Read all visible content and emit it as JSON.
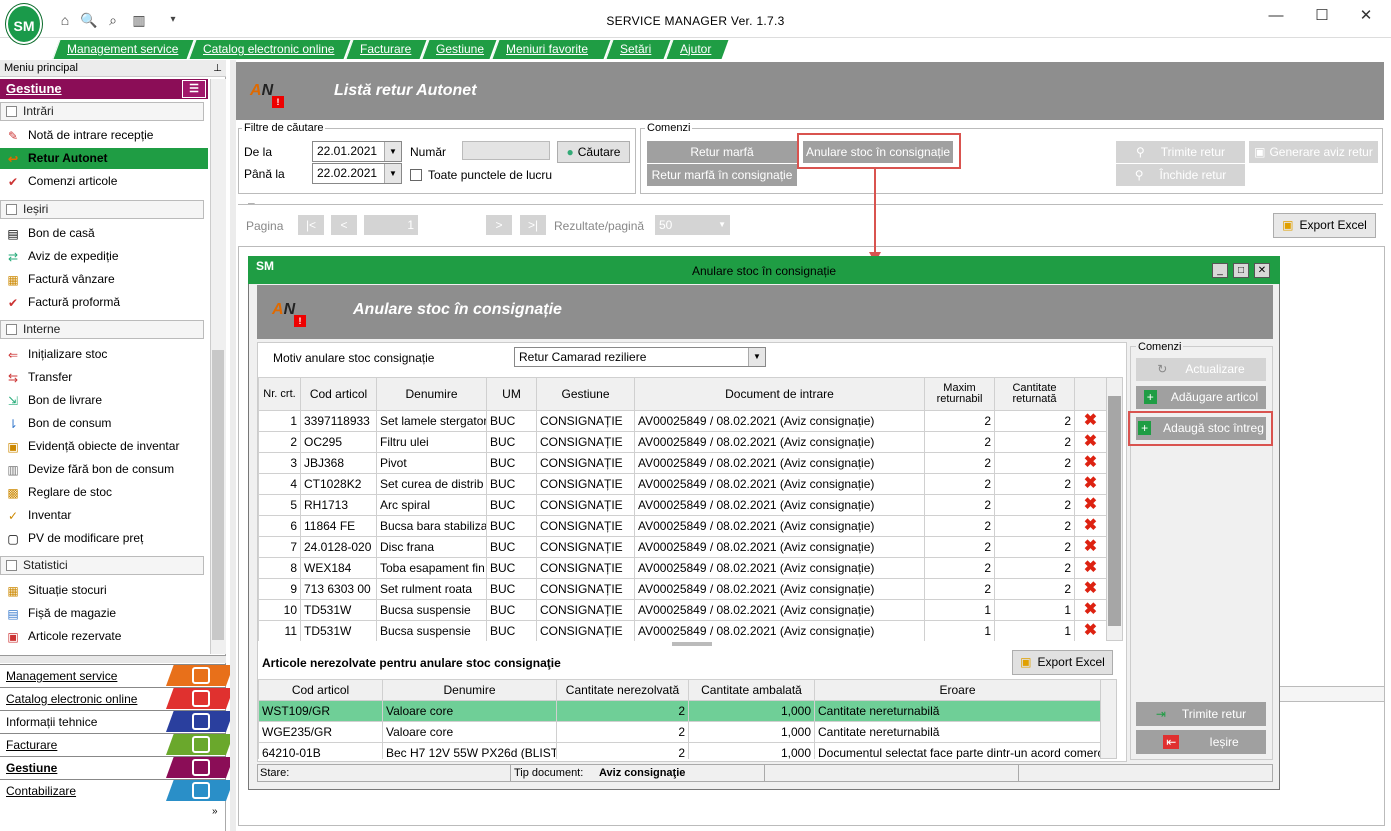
{
  "window": {
    "title": "SERVICE MANAGER Ver. 1.7.3",
    "logo_text": "SM"
  },
  "menubar": [
    "Management service",
    "Catalog electronic online",
    "Facturare",
    "Gestiune",
    "Meniuri favorite",
    "Setări",
    "Ajutor"
  ],
  "sidebar": {
    "header": "Meniu principal",
    "section_title": "Gestiune",
    "groups": [
      {
        "label": "Intrări",
        "items": [
          "Notă de intrare recepție",
          "Retur Autonet",
          "Comenzi articole"
        ]
      },
      {
        "label": "Ieșiri",
        "items": [
          "Bon de casă",
          "Aviz de expediție",
          "Factură vânzare",
          "Factură proformă"
        ]
      },
      {
        "label": "Interne",
        "items": [
          "Inițializare stoc",
          "Transfer",
          "Bon de livrare",
          "Bon de consum",
          "Evidență obiecte de inventar",
          "Devize fără bon de consum",
          "Reglare de stoc",
          "Inventar",
          "PV de modificare preț"
        ]
      },
      {
        "label": "Statistici",
        "items": [
          "Situație stocuri",
          "Fișă de magazie",
          "Articole rezervate"
        ]
      }
    ],
    "active_item": "Retur Autonet",
    "modules": [
      "Management service",
      "Catalog electronic online",
      "Informații tehnice",
      "Facturare",
      "Gestiune",
      "Contabilizare"
    ],
    "module_colors": [
      "#e8701a",
      "#e0312f",
      "#2a3f9e",
      "#6aa82c",
      "#8b0d57",
      "#2a8fc8"
    ]
  },
  "main": {
    "title": "Listă retur Autonet",
    "filters": {
      "group_label": "Filtre de căutare",
      "from_label": "De la",
      "from_value": "22.01.2021",
      "to_label": "Până la",
      "to_value": "22.02.2021",
      "number_label": "Număr",
      "number_value": "",
      "all_points_label": "Toate punctele de lucru",
      "search_button": "Căutare"
    },
    "commands": {
      "group_label": "Comenzi",
      "retur_marfa": "Retur marfă",
      "anulare_stoc": "Anulare stoc în consignație",
      "retur_marfa_consignatie": "Retur marfă în consignație",
      "trimite_retur": "Trimite retur",
      "inchide_retur": "Închide retur",
      "generare_aviz": "Generare aviz retur"
    },
    "pager": {
      "page_label": "Pagina",
      "page_value": "1",
      "first": "|<",
      "prev": "<",
      "next": ">",
      "last": ">|",
      "results_label": "Rezultate/pagină",
      "results_value": "50"
    },
    "export_button": "Export Excel"
  },
  "modal": {
    "window_title": "Anulare stoc în consignație",
    "header": "Anulare stoc în consignație",
    "motiv_label": "Motiv anulare stoc consignație",
    "motiv_value": "Retur Camarad reziliere",
    "columns": [
      "Nr. crt.",
      "Cod articol",
      "Denumire",
      "UM",
      "Gestiune",
      "Document de intrare",
      "Maxim returnabil",
      "Cantitate returnată"
    ],
    "rows": [
      {
        "nr": "1",
        "cod": "3397118933",
        "den": "Set lamele stergator",
        "um": "BUC",
        "gest": "CONSIGNAȚIE",
        "doc": "AV00025849 / 08.02.2021 (Aviz consignație)",
        "max": "2",
        "cant": "2"
      },
      {
        "nr": "2",
        "cod": "OC295",
        "den": "Filtru ulei",
        "um": "BUC",
        "gest": "CONSIGNAȚIE",
        "doc": "AV00025849 / 08.02.2021 (Aviz consignație)",
        "max": "2",
        "cant": "2"
      },
      {
        "nr": "3",
        "cod": "JBJ368",
        "den": "Pivot",
        "um": "BUC",
        "gest": "CONSIGNAȚIE",
        "doc": "AV00025849 / 08.02.2021 (Aviz consignație)",
        "max": "2",
        "cant": "2"
      },
      {
        "nr": "4",
        "cod": "CT1028K2",
        "den": "Set curea de distrib",
        "um": "BUC",
        "gest": "CONSIGNAȚIE",
        "doc": "AV00025849 / 08.02.2021 (Aviz consignație)",
        "max": "2",
        "cant": "2"
      },
      {
        "nr": "5",
        "cod": "RH1713",
        "den": "Arc spiral",
        "um": "BUC",
        "gest": "CONSIGNAȚIE",
        "doc": "AV00025849 / 08.02.2021 (Aviz consignație)",
        "max": "2",
        "cant": "2"
      },
      {
        "nr": "6",
        "cod": "11864 FE",
        "den": "Bucsa bara stabiliza",
        "um": "BUC",
        "gest": "CONSIGNAȚIE",
        "doc": "AV00025849 / 08.02.2021 (Aviz consignație)",
        "max": "2",
        "cant": "2"
      },
      {
        "nr": "7",
        "cod": "24.0128-020",
        "den": "Disc frana",
        "um": "BUC",
        "gest": "CONSIGNAȚIE",
        "doc": "AV00025849 / 08.02.2021 (Aviz consignație)",
        "max": "2",
        "cant": "2"
      },
      {
        "nr": "8",
        "cod": "WEX184",
        "den": "Toba esapament fin",
        "um": "BUC",
        "gest": "CONSIGNAȚIE",
        "doc": "AV00025849 / 08.02.2021 (Aviz consignație)",
        "max": "2",
        "cant": "2"
      },
      {
        "nr": "9",
        "cod": "713 6303 00",
        "den": "Set rulment roata",
        "um": "BUC",
        "gest": "CONSIGNAȚIE",
        "doc": "AV00025849 / 08.02.2021 (Aviz consignație)",
        "max": "2",
        "cant": "2"
      },
      {
        "nr": "10",
        "cod": "TD531W",
        "den": "Bucsa suspensie",
        "um": "BUC",
        "gest": "CONSIGNAȚIE",
        "doc": "AV00025849 / 08.02.2021 (Aviz consignație)",
        "max": "1",
        "cant": "1"
      },
      {
        "nr": "11",
        "cod": "TD531W",
        "den": "Bucsa suspensie",
        "um": "BUC",
        "gest": "CONSIGNAȚIE",
        "doc": "AV00025849 / 08.02.2021 (Aviz consignație)",
        "max": "1",
        "cant": "1"
      }
    ],
    "unresolved_title": "Articole nerezolvate pentru anulare stoc consignaţie",
    "export_button": "Export Excel",
    "unresolved_columns": [
      "Cod articol",
      "Denumire",
      "Cantitate nerezolvată",
      "Cantitate ambalată",
      "Eroare"
    ],
    "unresolved_rows": [
      {
        "cod": "WST109/GR",
        "den": "Valoare core",
        "nerez": "2",
        "amb": "1,000",
        "err": "Cantitate nereturnabilă"
      },
      {
        "cod": "WGE235/GR",
        "den": "Valoare core",
        "nerez": "2",
        "amb": "1,000",
        "err": "Cantitate nereturnabilă"
      },
      {
        "cod": "64210-01B",
        "den": "Bec H7 12V 55W PX26d (BLIST",
        "nerez": "2",
        "amb": "1,000",
        "err": "Documentul selectat face parte dintr-un acord comerci"
      }
    ],
    "commands_label": "Comenzi",
    "actualizare": "Actualizare",
    "adaugare_articol": "Adăugare articol",
    "adauga_stoc": "Adaugă stoc întreg",
    "trimite_retur": "Trimite retur",
    "iesire": "Ieșire",
    "status": {
      "stare_label": "Stare:",
      "tip_label": "Tip document:",
      "tip_value": "Aviz consignaţie"
    }
  },
  "colors": {
    "green": "#1f9d44",
    "gestiune": "#8b0d57",
    "banner": "#8e8e8e",
    "highlight": "#d9534f",
    "selected_row": "#6fcf97"
  }
}
